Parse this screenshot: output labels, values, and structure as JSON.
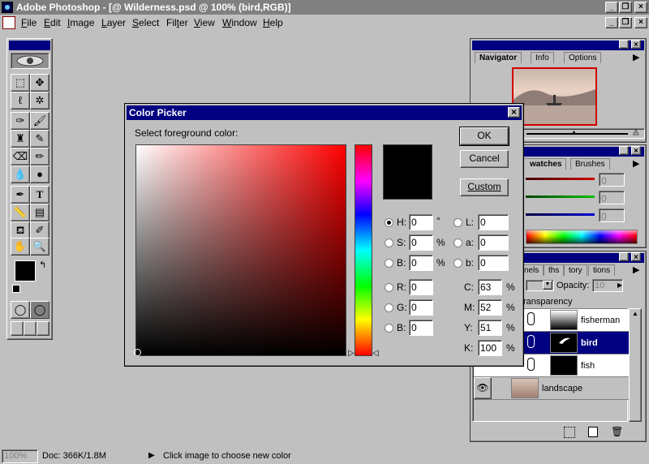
{
  "window": {
    "title": "Adobe Photoshop - [@ Wilderness.psd @ 100% (bird,RGB)]"
  },
  "menu": [
    "File",
    "Edit",
    "Image",
    "Layer",
    "Select",
    "Filter",
    "View",
    "Window",
    "Help"
  ],
  "menu_underline": [
    "F",
    "E",
    "I",
    "L",
    "S",
    "t",
    "V",
    "W",
    "H"
  ],
  "menu_rest": [
    "ile",
    "dit",
    "mage",
    "ayer",
    "elect",
    "",
    "iew",
    "indow",
    "elp"
  ],
  "menu_pre": [
    "",
    "",
    "",
    "",
    "",
    "Fil",
    "",
    "",
    ""
  ],
  "menu_post": [
    "",
    "",
    "",
    "",
    "",
    "er",
    "",
    "",
    ""
  ],
  "dialog": {
    "title": "Color Picker",
    "instruction": "Select foreground color:",
    "ok": "OK",
    "cancel": "Cancel",
    "custom": "Custom",
    "colors": {
      "selected": "#000000",
      "hue": "#ff0000"
    },
    "hsb": [
      {
        "label": "H:",
        "value": "0",
        "unit": "°"
      },
      {
        "label": "S:",
        "value": "0",
        "unit": "%"
      },
      {
        "label": "B:",
        "value": "0",
        "unit": "%"
      }
    ],
    "rgb": [
      {
        "label": "R:",
        "value": "0"
      },
      {
        "label": "G:",
        "value": "0"
      },
      {
        "label": "B:",
        "value": "0"
      }
    ],
    "lab": [
      {
        "label": "L:",
        "value": "0"
      },
      {
        "label": "a:",
        "value": "0"
      },
      {
        "label": "b:",
        "value": "0"
      }
    ],
    "cmyk": [
      {
        "label": "C:",
        "value": "63",
        "unit": "%"
      },
      {
        "label": "M:",
        "value": "52",
        "unit": "%"
      },
      {
        "label": "Y:",
        "value": "51",
        "unit": "%"
      },
      {
        "label": "K:",
        "value": "100",
        "unit": "%"
      }
    ]
  },
  "navigator": {
    "tabs": [
      "Navigator",
      "Info",
      "Options"
    ]
  },
  "swatches": {
    "tabs": [
      "watches",
      "Brushes"
    ],
    "slider_values": [
      "0",
      "0",
      "0"
    ]
  },
  "layers": {
    "tabs": [
      "nels",
      "ths",
      "tory",
      "tions"
    ],
    "opacity_label": "Opacity:",
    "opacity_value": "10",
    "preserve_label": "ransparency",
    "rows": [
      {
        "name": "fisherman"
      },
      {
        "name": "bird"
      },
      {
        "name": "fish"
      },
      {
        "name": "landscape"
      }
    ]
  },
  "status": {
    "zoom": "100%",
    "doc": "Doc: 366K/1.8M",
    "message": "Click image to choose new color"
  }
}
